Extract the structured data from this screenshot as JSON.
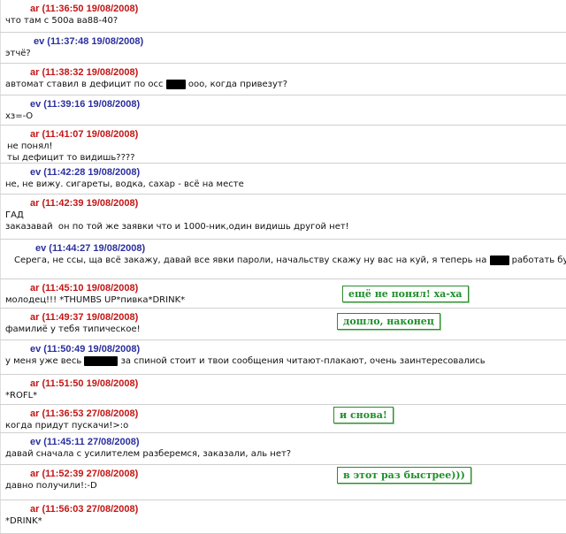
{
  "messages": [
    {
      "author": "ar",
      "time": "11:36:50",
      "date": "19/08/2008",
      "lines": [
        "что там с 500а ва88-40?"
      ]
    },
    {
      "author": "ev",
      "time": "11:37:48",
      "date": "19/08/2008",
      "lines": [
        "этчё?"
      ]
    },
    {
      "author": "ar",
      "time": "11:38:32",
      "date": "19/08/2008",
      "lines": [
        "автомат ставил в дефицит по осс ▮▮ ооо, когда привезут?"
      ]
    },
    {
      "author": "ev",
      "time": "11:39:16",
      "date": "19/08/2008",
      "lines": [
        "хз=-О"
      ]
    },
    {
      "author": "ar",
      "time": "11:41:07",
      "date": "19/08/2008",
      "lines": [
        "не понял!",
        "ты дефицит то видишь????"
      ]
    },
    {
      "author": "ev",
      "time": "11:42:28",
      "date": "19/08/2008",
      "lines": [
        "не, не вижу. сигареты, водка, сахар - всё на месте"
      ]
    },
    {
      "author": "ar",
      "time": "11:42:39",
      "date": "19/08/2008",
      "lines": [
        "ГАД",
        "заказавай  он по той же заявки что и 1000-ник,один видишь другой нет!"
      ]
    },
    {
      "author": "ev",
      "time": "11:44:27",
      "date": "19/08/2008",
      "lines": [
        "Серега, не ссы, ща всё закажу, давай все явки пароли, начальству скажу ну вас на куй, я теперь на ▮▮ работать буду"
      ]
    },
    {
      "author": "ar",
      "time": "11:45:10",
      "date": "19/08/2008",
      "lines": [
        "молодец!!! *THUMBS UP*пивка*DRINK*"
      ]
    },
    {
      "author": "ar",
      "time": "11:49:37",
      "date": "19/08/2008",
      "lines": [
        "фамилиё у тебя типическое!"
      ]
    },
    {
      "author": "ev",
      "time": "11:50:49",
      "date": "19/08/2008",
      "lines": [
        "у меня уже весь ▮▮ за спиной стоит и твои сообщения читают-плакают, очень заинтересовались"
      ]
    },
    {
      "author": "ar",
      "time": "11:51:50",
      "date": "19/08/2008",
      "lines": [
        "*ROFL*"
      ]
    },
    {
      "author": "ar",
      "time": "11:36:53",
      "date": "27/08/2008",
      "lines": [
        "когда придут пускачи!>:о"
      ]
    },
    {
      "author": "ev",
      "time": "11:45:11",
      "date": "27/08/2008",
      "lines": [
        "давай сначала с усилителем разберемся, заказали, аль нет?"
      ]
    },
    {
      "author": "ar",
      "time": "11:52:39",
      "date": "27/08/2008",
      "lines": [
        "давно получили!:-D"
      ]
    },
    {
      "author": "ar",
      "time": "11:56:03",
      "date": "27/08/2008",
      "lines": [
        "*DRINK*"
      ]
    }
  ],
  "notes": [
    "ещё не понял! ха-ха",
    "дошло, наконец",
    "и снова!",
    "в этот раз быстрее)))"
  ],
  "colors": {
    "ar": "#c41515",
    "ev": "#2a2f9e",
    "note": "#1f8f2a"
  }
}
